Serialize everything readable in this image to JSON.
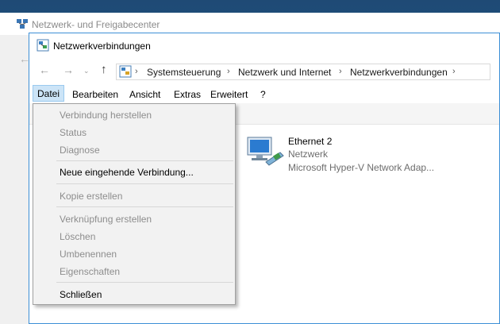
{
  "background_window": {
    "title": "Netzwerk- und Freigabecenter"
  },
  "window": {
    "title": "Netzwerkverbindungen",
    "breadcrumb": [
      "Systemsteuerung",
      "Netzwerk und Internet",
      "Netzwerkverbindungen"
    ]
  },
  "menubar": {
    "items": [
      "Datei",
      "Bearbeiten",
      "Ansicht",
      "Extras",
      "Erweitert",
      "?"
    ]
  },
  "dropdown": {
    "items": [
      {
        "label": "Verbindung herstellen",
        "enabled": false
      },
      {
        "label": "Status",
        "enabled": false
      },
      {
        "label": "Diagnose",
        "enabled": false
      },
      {
        "label": "Neue eingehende Verbindung...",
        "enabled": true
      },
      {
        "label": "Kopie erstellen",
        "enabled": false
      },
      {
        "label": "Verknüpfung erstellen",
        "enabled": false
      },
      {
        "label": "Löschen",
        "enabled": false
      },
      {
        "label": "Umbenennen",
        "enabled": false
      },
      {
        "label": "Eigenschaften",
        "enabled": false
      },
      {
        "label": "Schließen",
        "enabled": true
      }
    ]
  },
  "connection": {
    "name": "Ethernet 2",
    "status": "Netzwerk",
    "adapter": "Microsoft Hyper-V Network Adap..."
  },
  "icons": {
    "window": "network-connections-icon",
    "background_window": "network-center-icon",
    "connection": "ethernet-adapter-icon"
  }
}
